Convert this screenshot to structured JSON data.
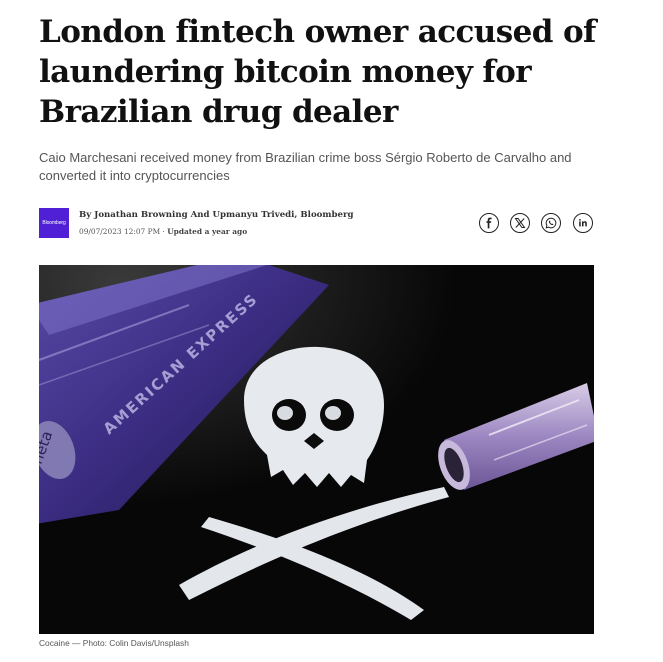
{
  "article": {
    "headline": "London fintech owner accused of laundering bitcoin money for Brazilian drug dealer",
    "subheadline": "Caio Marchesani received money from Brazilian crime boss Sérgio Roberto de Carvalho and converted it into cryptocurrencies",
    "publisher_logo_text": "Bloomberg",
    "byline": "By Jonathan Browning And Upmanyu Trivedi, Bloomberg",
    "date": "09/07/2023 12:07 PM",
    "updated": "Updated a year ago",
    "share": {
      "facebook": "f",
      "x": "𝕏",
      "whatsapp": "whatsapp-icon",
      "linkedin": "in"
    },
    "image": {
      "card_text": "AMERICAN EXPRESS",
      "card_logo": "neta"
    },
    "caption": "Cocaine — Photo: Colin Davis/Unsplash"
  }
}
